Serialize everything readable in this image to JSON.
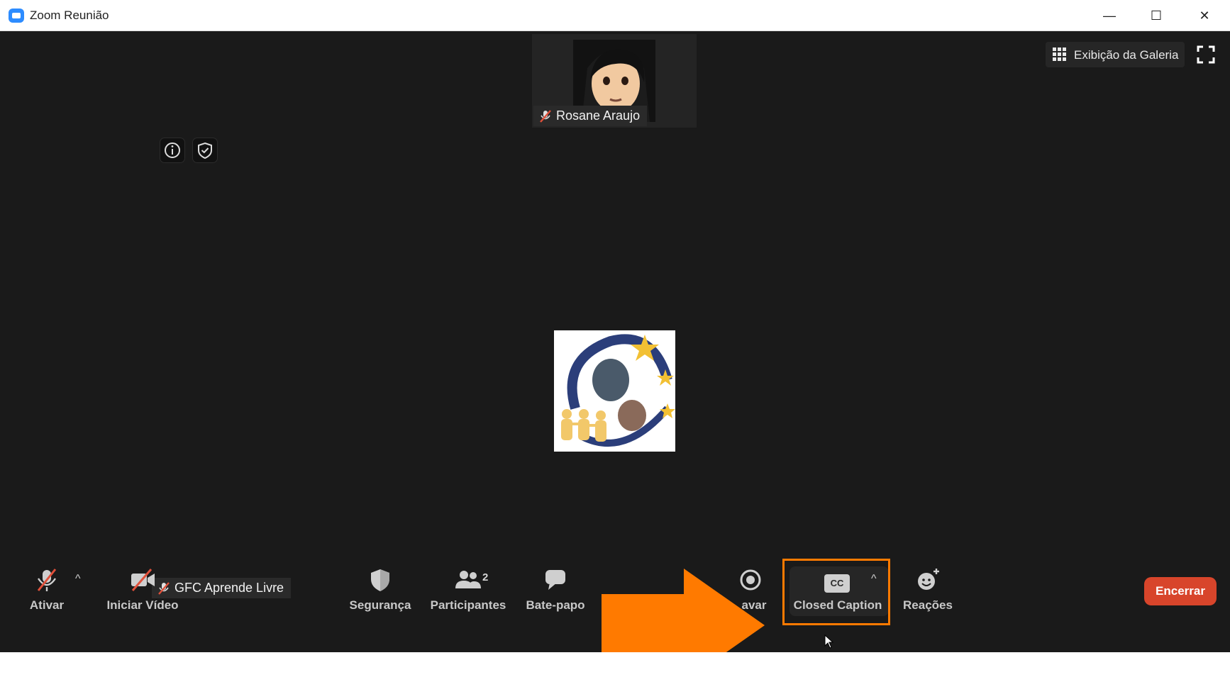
{
  "window": {
    "title": "Zoom Reunião",
    "minimize_glyph": "—",
    "maximize_glyph": "☐",
    "close_glyph": "✕"
  },
  "video": {
    "participant_top_name": "Rosane Araujo",
    "self_name": "GFC Aprende Livre",
    "gallery_view_label": "Exibição da Galeria"
  },
  "toolbar": {
    "mute_label": "Ativar",
    "video_label": "Iniciar Vídeo",
    "security_label": "Segurança",
    "participants_label": "Participantes",
    "participants_count": "2",
    "chat_label": "Bate-papo",
    "record_label_visible": "avar",
    "closed_caption_label": "Closed Caption",
    "cc_icon_text": "CC",
    "reactions_label": "Reações",
    "end_label": "Encerrar",
    "caret_glyph": "^"
  },
  "colors": {
    "meeting_background": "#1a1a1a",
    "highlight": "#ff7a00",
    "end_button": "#d8452b",
    "app_blue": "#2d8cff"
  },
  "icons": [
    "zoom-app-icon",
    "info-icon",
    "shield-check-icon",
    "grid-icon",
    "fullscreen-icon",
    "muted-mic-icon",
    "video-off-icon",
    "security-shield-icon",
    "participants-icon",
    "chat-bubble-icon",
    "record-icon",
    "cc-icon",
    "reaction-smiley-icon",
    "arrow-right-icon",
    "cursor-icon"
  ]
}
